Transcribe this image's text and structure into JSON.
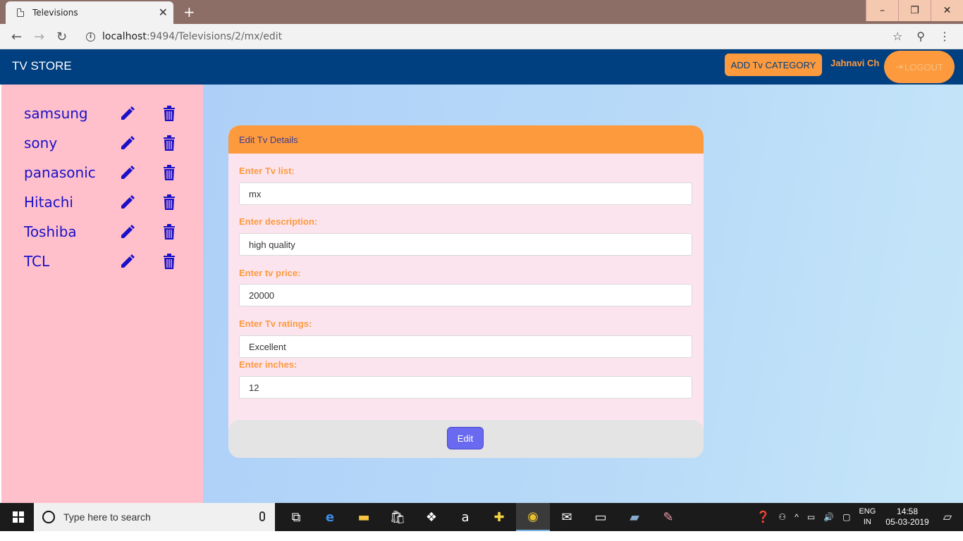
{
  "browser": {
    "tab_title": "Televisions",
    "url_host": "localhost",
    "url_path": ":9494/Televisions/2/mx/edit"
  },
  "navbar": {
    "brand": "TV STORE",
    "add_category_label": "ADD Tv CATEGORY",
    "username": "Jahnavi Ch",
    "logout_label": "LOGOUT"
  },
  "sidebar": {
    "items": [
      {
        "label": "samsung"
      },
      {
        "label": "sony"
      },
      {
        "label": "panasonic"
      },
      {
        "label": "Hitachi"
      },
      {
        "label": "Toshiba"
      },
      {
        "label": "TCL"
      }
    ]
  },
  "form": {
    "header": "Edit Tv Details",
    "fields": [
      {
        "label": "Enter Tv list:",
        "value": "mx"
      },
      {
        "label": "Enter description:",
        "value": "high quality"
      },
      {
        "label": "Enter tv price:",
        "value": "20000"
      },
      {
        "label": "Enter Tv ratings:",
        "value": "Excellent"
      },
      {
        "label": "Enter inches:",
        "value": "12"
      }
    ],
    "submit_label": "Edit"
  },
  "taskbar": {
    "search_placeholder": "Type here to search",
    "lang_top": "ENG",
    "lang_bottom": "IN",
    "time": "14:58",
    "date": "05-03-2019"
  },
  "colors": {
    "navbar": "#003f80",
    "accent": "#fd9a3e",
    "sidebar": "#ffc0cb",
    "brand_link": "#1a10c8",
    "edit_button": "#6a6af0"
  }
}
